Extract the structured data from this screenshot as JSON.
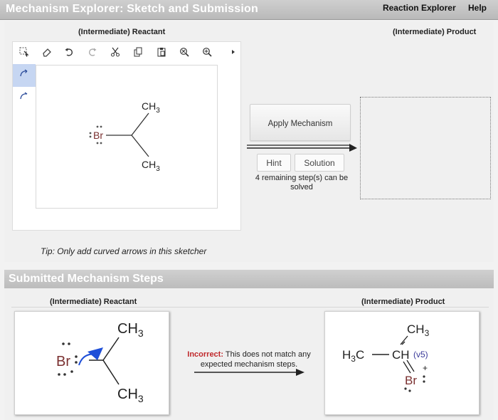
{
  "window": {
    "title": "Mechanism Explorer: Sketch and Submission",
    "links": [
      "Reaction Explorer",
      "Help"
    ]
  },
  "sketch": {
    "reactant_label": "(Intermediate) Reactant",
    "product_label": "(Intermediate) Product",
    "toolbar_icons": [
      "select-icon",
      "eraser-icon",
      "undo-icon",
      "redo-icon",
      "cut-icon",
      "copy-icon",
      "paste-icon",
      "zoom-out-icon",
      "zoom-in-icon",
      "more-icon"
    ],
    "side_tools": [
      "curved-arrow-two-electron-icon",
      "curved-arrow-one-electron-icon"
    ],
    "molecule": {
      "halogen": "Br",
      "methyl_top": "CH",
      "methyl_bottom": "CH",
      "subscript": "3"
    },
    "tip": "Tip: Only add curved arrows in this sketcher"
  },
  "actions": {
    "apply_label": "Apply Mechanism",
    "hint_label": "Hint",
    "solution_label": "Solution",
    "remaining_text": "4 remaining step(s) can be solved"
  },
  "submitted": {
    "title": "Submitted Mechanism Steps",
    "reactant_label": "(Intermediate) Reactant",
    "product_label": "(Intermediate) Product",
    "feedback_status": "Incorrect:",
    "feedback_text": " This does not match any expected mechanism steps.",
    "reactant": {
      "halogen": "Br",
      "methyl_top": "CH",
      "methyl_bottom": "CH",
      "subscript": "3"
    },
    "product": {
      "left_group": "H",
      "left_sub": "3",
      "left_c": "C",
      "center": "CH",
      "valence": "(v5)",
      "top": "CH",
      "top_sub": "3",
      "halogen": "Br",
      "charge": "+"
    }
  },
  "colors": {
    "bromine": "#7a3030",
    "arrow": "#1e4fd8",
    "valence": "#3a3a9a",
    "incorrect": "#c0282b"
  }
}
